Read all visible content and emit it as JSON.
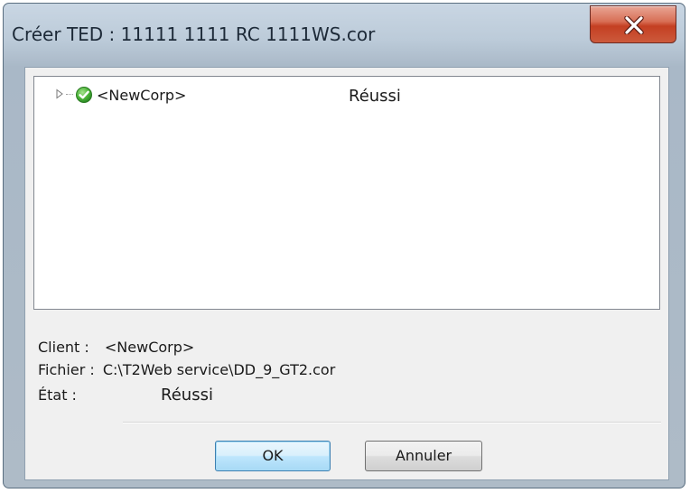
{
  "window": {
    "title": "Créer TED : 11111 1111 RC 1111WS.cor",
    "close_label": "X"
  },
  "tree": {
    "items": [
      {
        "name": "<NewCorp>",
        "status": "Réussi",
        "icon": "green-check-icon",
        "expander_icon": "expand-arrow-icon"
      }
    ]
  },
  "details": {
    "client_label": "Client :",
    "client_value": "<NewCorp>",
    "fichier_label": "Fichier :",
    "fichier_value": "C:\\T2Web service\\DD_9_GT2.cor",
    "etat_label": "État :",
    "etat_value": "Réussi"
  },
  "buttons": {
    "ok_label": "OK",
    "cancel_label": "Annuler"
  },
  "colors": {
    "close_button": "#c9452a",
    "status_success": "#3aa935",
    "ok_button_border": "#3c7fb1"
  }
}
